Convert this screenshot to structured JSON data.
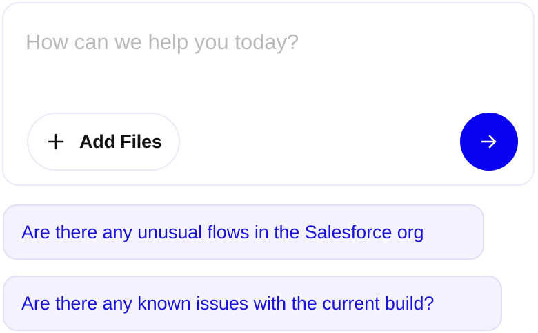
{
  "composer": {
    "placeholder": "How can we help you today?",
    "value": "",
    "add_files_label": "Add Files",
    "add_files_icon": "plus-icon",
    "send_icon": "arrow-right-icon",
    "send_button_color": "#0a00f0"
  },
  "suggestions": [
    {
      "label": "Are there any unusual flows in the Salesforce org"
    },
    {
      "label": "Are there any known issues with the current build?"
    }
  ],
  "colors": {
    "suggestion_text": "#1a12d8",
    "suggestion_bg": "#f4f3fd",
    "placeholder_text": "#b9b9b9"
  }
}
